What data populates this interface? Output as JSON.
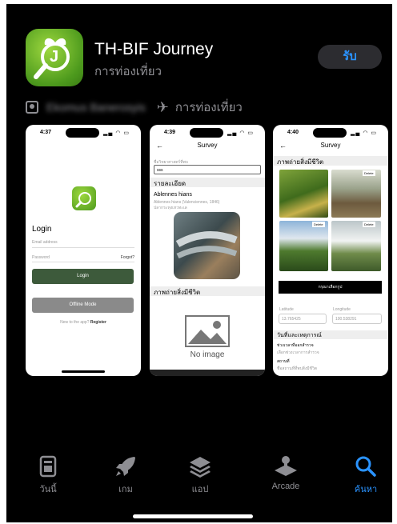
{
  "app": {
    "title": "TH-BIF Journey",
    "subtitle": "การท่องเที่ยว",
    "get_label": "รับ",
    "developer": "Ekomus Banerosyis",
    "category": "การท่องเที่ยว",
    "icon_letter": "J"
  },
  "shot1": {
    "time": "4:37",
    "login_title": "Login",
    "email_placeholder": "Email address",
    "password_placeholder": "Password",
    "forgot": "Forgot?",
    "login_button": "Login",
    "offline_button": "Offline Mode",
    "new_text": "New to the app?",
    "register": "Register"
  },
  "shot2": {
    "time": "4:39",
    "nav_title": "Survey",
    "field_label": "ชื่อวิทยาศาสตร์ที่พบ",
    "field_value": "sss",
    "section_detail": "รายละเอียด",
    "species": "Ablennes hians",
    "species_sub1": "Ablennes hians (Valenciennes, 1846)",
    "species_sub2": "ปลากระทุงเหวทะเล",
    "section_photos": "ภาพถ่ายสิ่งมีชีวิต",
    "no_image": "No image"
  },
  "shot3": {
    "time": "4:40",
    "nav_title": "Survey",
    "section_photos": "ภาพถ่ายสิ่งมีชีวิต",
    "delete_label": "Delete",
    "add_photo": "กรุณาเลือกรูป",
    "lat_label": "Latitude",
    "lon_label": "Longitude",
    "lat_value": "13.765425",
    "lon_value": "100.538291",
    "section_date": "วันที่และเหตุการณ์",
    "date_label": "ช่วงเวลาที่ออกสำรวจ",
    "date_value": "เลือกช่วงเวลาการสำรวจ",
    "place_label": "สถานที่",
    "place_value": "ชื่อสถานที่ที่พบสิ่งมีชีวิต"
  },
  "tabs": [
    {
      "label": "วันนี้",
      "icon": "today-icon"
    },
    {
      "label": "เกม",
      "icon": "rocket-icon"
    },
    {
      "label": "แอป",
      "icon": "layers-icon"
    },
    {
      "label": "Arcade",
      "icon": "joystick-icon"
    },
    {
      "label": "ค้นหา",
      "icon": "search-icon"
    }
  ],
  "colors": {
    "accent": "#2a93ff",
    "login_green": "#3d5a3b",
    "offline_grey": "#8a8a8a"
  }
}
